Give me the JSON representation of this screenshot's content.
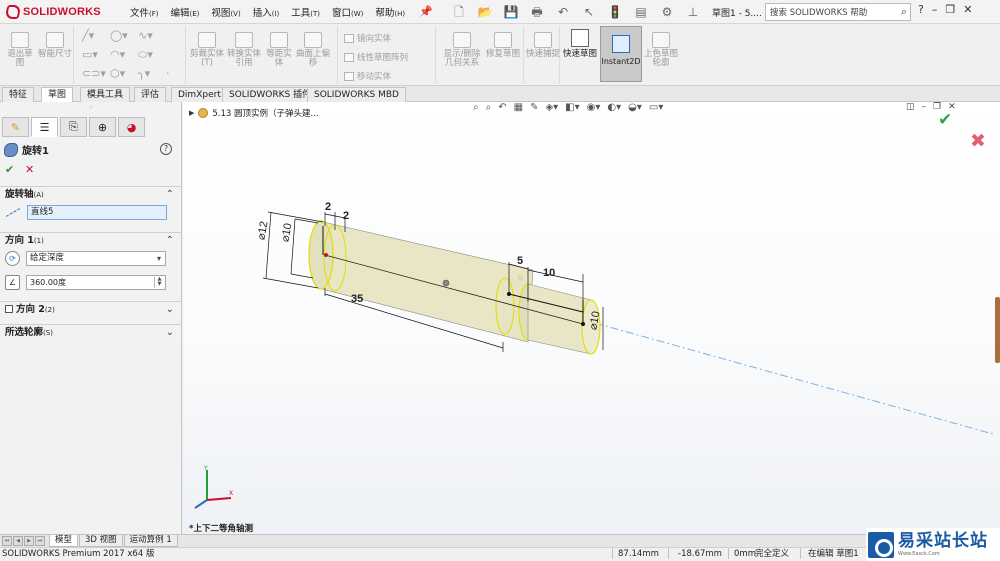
{
  "app": {
    "logo_text": "SOLIDWORKS",
    "doc_title": "草图1 - 5....",
    "search_placeholder": "搜索 SOLIDWORKS 帮助"
  },
  "menu": [
    {
      "label": "文件",
      "acc": "(F)"
    },
    {
      "label": "编辑",
      "acc": "(E)"
    },
    {
      "label": "视图",
      "acc": "(V)"
    },
    {
      "label": "插入",
      "acc": "(I)"
    },
    {
      "label": "工具",
      "acc": "(T)"
    },
    {
      "label": "窗口",
      "acc": "(W)"
    },
    {
      "label": "帮助",
      "acc": "(H)"
    }
  ],
  "ribbon": {
    "exit_sketch": "退出草图",
    "smart_dim": "智能尺寸",
    "trim": "剪裁实体(T)",
    "convert": "转换实体引用",
    "offset": "等距实体",
    "surface_offset": "曲面上偏移",
    "mirror": "镜向实体",
    "linear_pattern": "线性草图阵列",
    "move": "移动实体",
    "display_relations": "显示/删除几何关系",
    "repair": "修复草图",
    "rapid_snap": "快速捕捉",
    "quick_sketch": "快速草图",
    "instant2d": "Instant2D",
    "shaded_contours": "上色草图轮廓"
  },
  "tabs": [
    "特征",
    "草图",
    "模具工具",
    "评估",
    "DimXpert",
    "SOLIDWORKS 插件",
    "SOLIDWORKS MBD"
  ],
  "active_tab": 1,
  "panel": {
    "feature_name": "旋转1",
    "axis_section": "旋转轴",
    "axis_acc": "(A)",
    "axis_value": "直线5",
    "dir1_section": "方向 1",
    "dir1_acc": "(1)",
    "end_condition": "给定深度",
    "angle_value": "360.00度",
    "dir2_section": "方向 2",
    "dir2_acc": "(2)",
    "contours_section": "所选轮廓",
    "contours_acc": "(S)"
  },
  "viewport": {
    "tree_item": "5.13 圆顶实例（子弹头建...",
    "view_orientation": "*上下二等角轴测",
    "dims": {
      "d12": "⌀12",
      "d10_left": "⌀10",
      "d10_right": "⌀10",
      "two_a": "2",
      "two_b": "2",
      "five": "5",
      "ten": "10",
      "thirty_five": "35"
    }
  },
  "bottom_tabs": [
    "模型",
    "3D 视图",
    "运动算例 1"
  ],
  "status": {
    "product": "SOLIDWORKS Premium 2017 x64 版",
    "x": "87.14mm",
    "y": "-18.67mm",
    "z": "0mm",
    "defined": "完全定义",
    "editing": "在编辑 草图1"
  },
  "watermark": {
    "main": "易采站长站",
    "sub": "Www.Easck.Com"
  },
  "colors": {
    "brand": "#c8102e",
    "part_fill": "#e8e6c4",
    "edge_highlight": "#e3dd00",
    "axis_line": "#7fb2e5"
  }
}
